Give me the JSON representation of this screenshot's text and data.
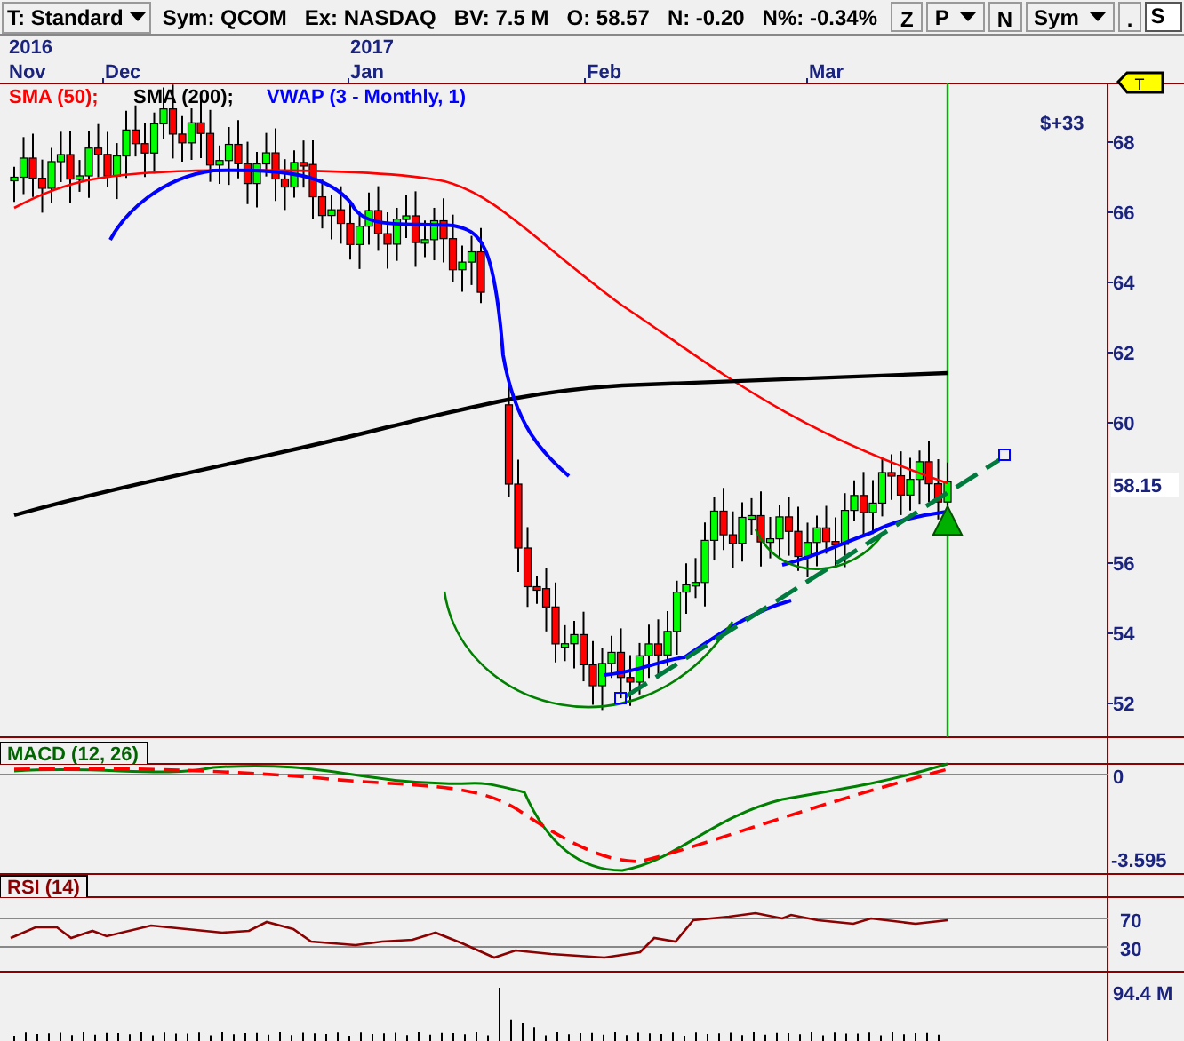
{
  "toolbar": {
    "template": "T: Standard",
    "symbol": "Sym: QCOM",
    "exchange": "Ex: NASDAQ",
    "bar_volume": "BV: 7.5 M",
    "open": "O: 58.57",
    "net_change": "N: -0.20",
    "percent_change": "N%: -0.34%",
    "buttons": [
      {
        "label": "Z",
        "kind": "plain"
      },
      {
        "label": "P",
        "kind": "dropdown"
      },
      {
        "label": "N",
        "kind": "plain"
      },
      {
        "label": "Sym",
        "kind": "dropdown"
      },
      {
        "label": ".",
        "kind": "plain"
      }
    ],
    "field_value": "S"
  },
  "time_axis": {
    "years": [
      "2016",
      "2017"
    ],
    "months": [
      "Nov",
      "Dec",
      "Jan",
      "Feb",
      "Mar"
    ]
  },
  "price_panel": {
    "legend": [
      {
        "label": "SMA (50);",
        "color": "#ff0000"
      },
      {
        "label": "SMA (200);",
        "color": "#000000"
      },
      {
        "label": "VWAP (3 - Monthly, 1)",
        "color": "#0000ff"
      }
    ],
    "tag": "T",
    "profit": "$+33",
    "price_ticks": [
      "68",
      "66",
      "64",
      "62",
      "60",
      "56",
      "54",
      "52"
    ],
    "last_price": "58.15"
  },
  "macd_panel": {
    "title": "MACD (12, 26)",
    "ticks": [
      "0",
      "-3.595"
    ]
  },
  "rsi_panel": {
    "title": "RSI (14)",
    "ticks": [
      "70",
      "30"
    ]
  },
  "volume_panel": {
    "max_label": "94.4 M"
  }
}
